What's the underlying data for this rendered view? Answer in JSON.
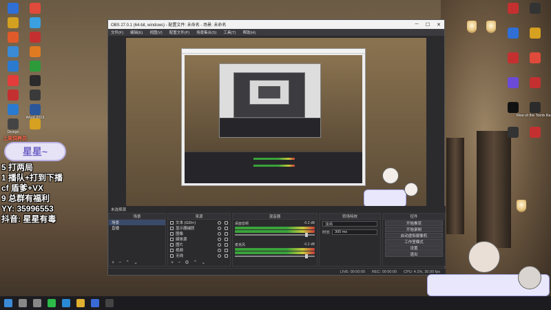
{
  "desktop_icons": [
    {
      "label": "",
      "color": "#2f6fd6"
    },
    {
      "label": "",
      "color": "#e04a3a"
    },
    {
      "label": "",
      "color": "#d4a020"
    },
    {
      "label": "",
      "color": "#3aa0e0"
    },
    {
      "label": "",
      "color": "#e05a2a"
    },
    {
      "label": "",
      "color": "#c43030"
    },
    {
      "label": "",
      "color": "#3a8ad6"
    },
    {
      "label": "",
      "color": "#e07a20"
    },
    {
      "label": "",
      "color": "#2a7ad0"
    },
    {
      "label": "",
      "color": "#2d9b3a"
    },
    {
      "label": "",
      "color": "#e43b3b"
    },
    {
      "label": "",
      "color": "#2b2b2b"
    },
    {
      "label": "",
      "color": "#c43030"
    },
    {
      "label": "",
      "color": "#3a3a3a"
    },
    {
      "label": "",
      "color": "#2a7ad0"
    },
    {
      "label": "Word 2013",
      "color": "#2b579a"
    },
    {
      "label": "Design",
      "color": "#444"
    },
    {
      "label": "",
      "color": "#d6a020"
    }
  ],
  "right_icons": [
    {
      "label": "",
      "color": "#c43030"
    },
    {
      "label": "",
      "color": "#333"
    },
    {
      "label": "",
      "color": "#2f6fd6"
    },
    {
      "label": "",
      "color": "#d6a020"
    },
    {
      "label": "",
      "color": "#c43030"
    },
    {
      "label": "",
      "color": "#e04a3a"
    },
    {
      "label": "",
      "color": "#6a4ad6"
    },
    {
      "label": "",
      "color": "#c43030"
    },
    {
      "label": "",
      "color": "#111"
    },
    {
      "label": "Rise of the Tomb Ra...",
      "color": "#2b2b2b"
    },
    {
      "label": "",
      "color": "#333"
    },
    {
      "label": "",
      "color": "#c43030"
    }
  ],
  "overlay": {
    "head": "上周饲养员",
    "title": "星星~",
    "lines": [
      "5 打两局",
      "1 播队+打到下播",
      "cf 盾爹+VX",
      "9 总群有福利",
      "YY: 35996553",
      "抖音: 星星有毒"
    ]
  },
  "obs": {
    "title": "OBS 27.0.1 (64-bit, windows) - 配置文件: 未命名 - 场景: 未命名",
    "menu": [
      "文件(F)",
      "编辑(E)",
      "视图(V)",
      "配置文件(P)",
      "场景集合(S)",
      "工具(T)",
      "帮助(H)"
    ],
    "docks_header": "未选择源",
    "scenes": {
      "title": "场景",
      "items": [
        "场景",
        "直播"
      ]
    },
    "sources": {
      "title": "来源",
      "items": [
        "文本 (GDI+)",
        "显示器捕获",
        "图像",
        "媒体源",
        "图片",
        "视频",
        "无线"
      ]
    },
    "mixer": {
      "title": "混音器",
      "channels": [
        {
          "name": "桌面音频",
          "db": "-0.2 dB"
        },
        {
          "name": "麦克风",
          "db": "-0.2 dB"
        }
      ]
    },
    "transitions": {
      "title": "转场特效",
      "type_label": "淡出",
      "duration_label": "时长",
      "duration_value": "300 ms"
    },
    "controls": {
      "title": "控件",
      "buttons": [
        "开始推流",
        "开始录制",
        "启动虚拟摄像机",
        "工作室模式",
        "设置",
        "退出"
      ]
    },
    "status": {
      "live": "LIVE: 00:00:00",
      "rec": "REC: 00:00:00",
      "cpu": "CPU: 4.1%, 30.00 fps"
    }
  },
  "taskbar": {
    "icons": [
      {
        "name": "start-icon",
        "color": "#3a8ad6"
      },
      {
        "name": "search-icon",
        "color": "#888"
      },
      {
        "name": "task-view-icon",
        "color": "#888"
      },
      {
        "name": "wechat-icon",
        "color": "#2dbb4a"
      },
      {
        "name": "edge-icon",
        "color": "#2a8ad6"
      },
      {
        "name": "explorer-icon",
        "color": "#e0b030"
      },
      {
        "name": "store-icon",
        "color": "#3a6ad6"
      },
      {
        "name": "obs-icon",
        "color": "#444"
      }
    ]
  }
}
